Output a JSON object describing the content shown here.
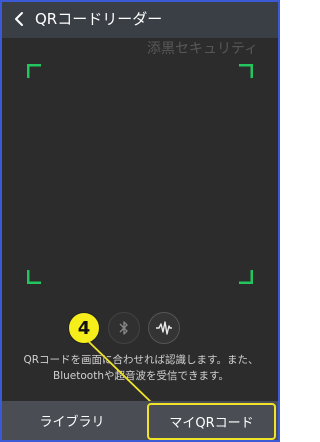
{
  "header": {
    "title": "QRコードリーダー",
    "back_icon": "chevron-left-icon"
  },
  "watermark": "添黒セキュリティ",
  "scanner": {
    "corner_color": "#22c55e",
    "bluetooth_icon": "bluetooth-icon",
    "sound_wave_icon": "sound-wave-icon"
  },
  "info_text": "QRコードを画面に合わせれば認識します。また、Bluetoothや超音波を受信できます。",
  "annotation": {
    "number": "4",
    "color": "#f5ee1a"
  },
  "bottom_bar": {
    "library_label": "ライブラリ",
    "my_qr_label": "マイQRコード"
  },
  "colors": {
    "accent_border": "#3b5bd6",
    "highlight": "#f0e32a",
    "background": "#2c2c2c"
  }
}
